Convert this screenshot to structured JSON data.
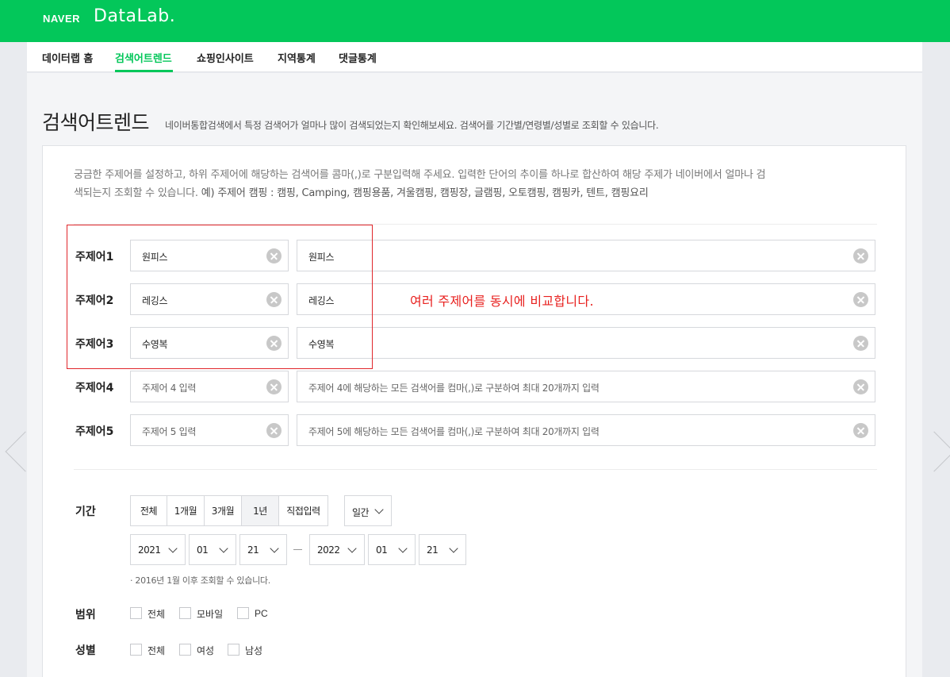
{
  "header": {
    "brand": "NAVER",
    "product": "DataLab."
  },
  "gnb": {
    "items": [
      {
        "label": "데이터랩 홈"
      },
      {
        "label": "검색어트렌드"
      },
      {
        "label": "쇼핑인사이트"
      },
      {
        "label": "지역통계"
      },
      {
        "label": "댓글통계"
      }
    ],
    "active_index": 1
  },
  "page": {
    "title": "검색어트렌드",
    "description": "네이버통합검색에서 특정 검색어가 얼마나 많이 검색되었는지 확인해보세요. 검색어를 기간별/연령별/성별로 조회할 수 있습니다."
  },
  "intro": {
    "line1": "궁금한 주제어를 설정하고, 하위 주제어에 해당하는 검색어를 콤마(,)로 구분입력해 주세요. 입력한 단어의 추이를 하나로 합산하여 해당 주제가 네이버에서 얼마나 검",
    "line2_start": "색되는지 조회할 수 있습니다. ",
    "line2_example": "예) 주제어 캠핑 : 캠핑, Camping, 캠핑용품, 겨울캠핑, 캠핑장, 글램핑, 오토캠핑, 캠핑카, 텐트, 캠핑요리"
  },
  "subjects": [
    {
      "label": "주제어1",
      "topic": "원피스",
      "topic_placeholder": "",
      "keywords": "원피스",
      "keywords_placeholder": ""
    },
    {
      "label": "주제어2",
      "topic": "레깅스",
      "topic_placeholder": "",
      "keywords": "레깅스",
      "keywords_placeholder": ""
    },
    {
      "label": "주제어3",
      "topic": "수영복",
      "topic_placeholder": "",
      "keywords": "수영복",
      "keywords_placeholder": ""
    },
    {
      "label": "주제어4",
      "topic": "",
      "topic_placeholder": "주제어 4 입력",
      "keywords": "",
      "keywords_placeholder": "주제어 4에 해당하는 모든 검색어를 컴마(,)로 구분하여 최대 20개까지 입력"
    },
    {
      "label": "주제어5",
      "topic": "",
      "topic_placeholder": "주제어 5 입력",
      "keywords": "",
      "keywords_placeholder": "주제어 5에 해당하는 모든 검색어를 컴마(,)로 구분하여 최대 20개까지 입력"
    }
  ],
  "annotation": "여러 주제어를 동시에 비교합니다.",
  "annotation_color": "#e8211f",
  "period": {
    "label": "기간",
    "options": [
      "전체",
      "1개월",
      "3개월",
      "1년",
      "직접입력"
    ],
    "active_index": 3,
    "interval": "일간",
    "start": {
      "year": "2021",
      "month": "01",
      "day": "21"
    },
    "end": {
      "year": "2022",
      "month": "01",
      "day": "21"
    },
    "note": "· 2016년 1월 이후 조회할 수 있습니다."
  },
  "scope": {
    "label": "범위",
    "options": [
      "전체",
      "모바일",
      "PC"
    ]
  },
  "gender": {
    "label": "성별",
    "options": [
      "전체",
      "여성",
      "남성"
    ]
  },
  "colors": {
    "brand_green": "#03c75a",
    "highlight_red": "#e0262b"
  }
}
